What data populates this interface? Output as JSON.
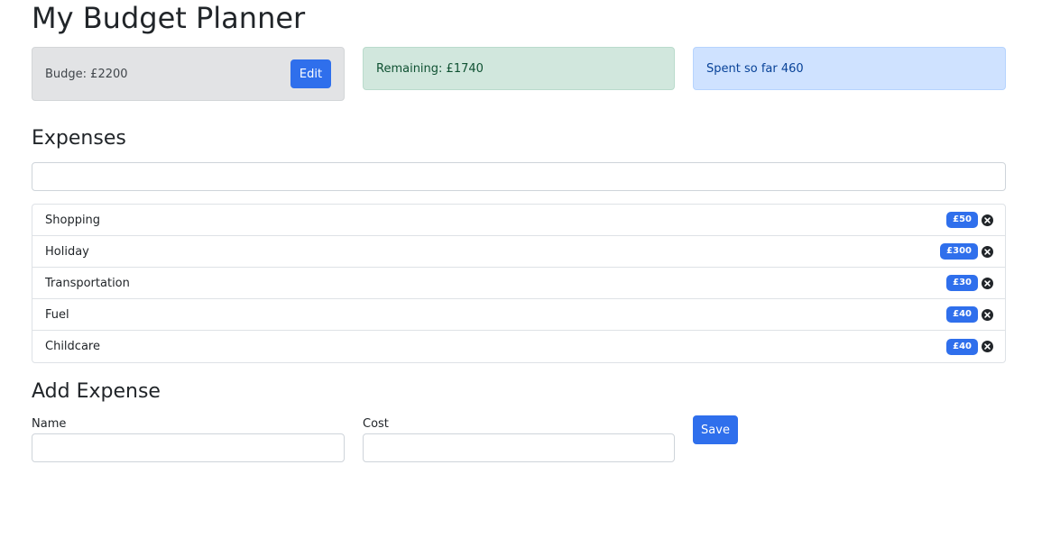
{
  "page": {
    "title": "My Budget Planner"
  },
  "summary": {
    "budget_label": "Budge: £2200",
    "edit_label": "Edit",
    "remaining_label": "Remaining: £1740",
    "spent_label": "Spent so far 460"
  },
  "expenses": {
    "title": "Expenses",
    "search_value": "",
    "items": [
      {
        "name": "Shopping",
        "cost": "£50"
      },
      {
        "name": "Holiday",
        "cost": "£300"
      },
      {
        "name": "Transportation",
        "cost": "£30"
      },
      {
        "name": "Fuel",
        "cost": "£40"
      },
      {
        "name": "Childcare",
        "cost": "£40"
      }
    ]
  },
  "add_expense": {
    "title": "Add Expense",
    "name_label": "Name",
    "name_value": "",
    "cost_label": "Cost",
    "cost_value": "",
    "save_label": "Save"
  },
  "colors": {
    "primary": "#2f6fec",
    "budget_bg": "#e2e3e5",
    "remaining_bg": "#d1e7dd",
    "spent_bg": "#cfe2ff"
  },
  "icons": {
    "delete": "x-circle-icon"
  }
}
